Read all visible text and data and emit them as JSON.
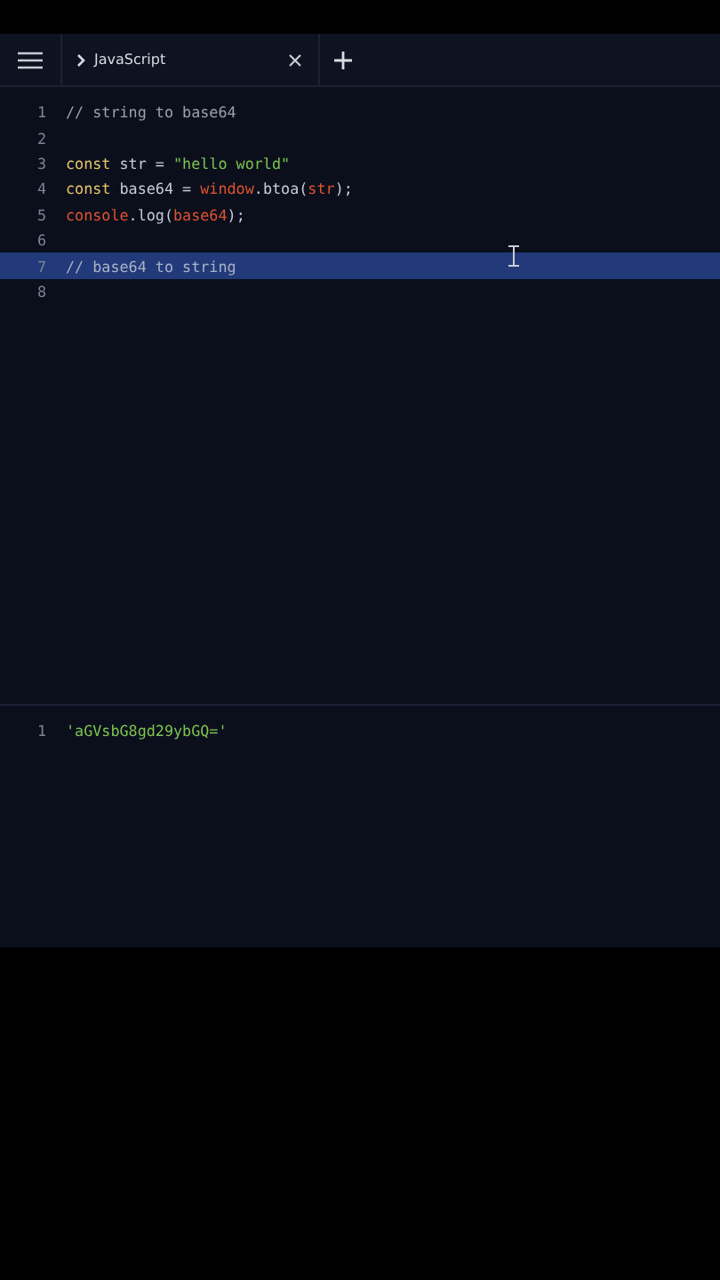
{
  "toolbar": {
    "tabs": [
      {
        "label": "JavaScript",
        "selected": true
      }
    ]
  },
  "editor": {
    "lines": [
      {
        "number": "1",
        "selected": false,
        "tokens": [
          {
            "kind": "comment",
            "text": "// string to base64"
          }
        ]
      },
      {
        "number": "2",
        "selected": false
      },
      {
        "number": "3",
        "selected": false,
        "tokens": [
          {
            "kind": "keyword",
            "text": "const"
          },
          {
            "kind": "plain",
            "text": " str = "
          },
          {
            "kind": "string",
            "text": "\"hello world\""
          }
        ]
      },
      {
        "number": "4",
        "selected": false,
        "tokens": [
          {
            "kind": "keyword",
            "text": "const"
          },
          {
            "kind": "plain",
            "text": " base64 = "
          },
          {
            "kind": "builtin",
            "text": "window"
          },
          {
            "kind": "plain",
            "text": ".btoa("
          },
          {
            "kind": "builtin",
            "text": "str"
          },
          {
            "kind": "plain",
            "text": ");"
          }
        ]
      },
      {
        "number": "5",
        "selected": false,
        "tokens": [
          {
            "kind": "builtin",
            "text": "console"
          },
          {
            "kind": "plain",
            "text": ".log("
          },
          {
            "kind": "builtin",
            "text": "base64"
          },
          {
            "kind": "plain",
            "text": ");"
          }
        ]
      },
      {
        "number": "6",
        "selected": false
      },
      {
        "number": "7",
        "selected": true,
        "tokens": [
          {
            "kind": "comment",
            "text": "// base64 to string"
          }
        ]
      },
      {
        "number": "8",
        "selected": false
      }
    ]
  },
  "output": {
    "lines": [
      {
        "number": "1",
        "tokens": [
          {
            "kind": "string",
            "text": "'aGVsbG8gd29ybGQ='"
          }
        ]
      }
    ]
  }
}
